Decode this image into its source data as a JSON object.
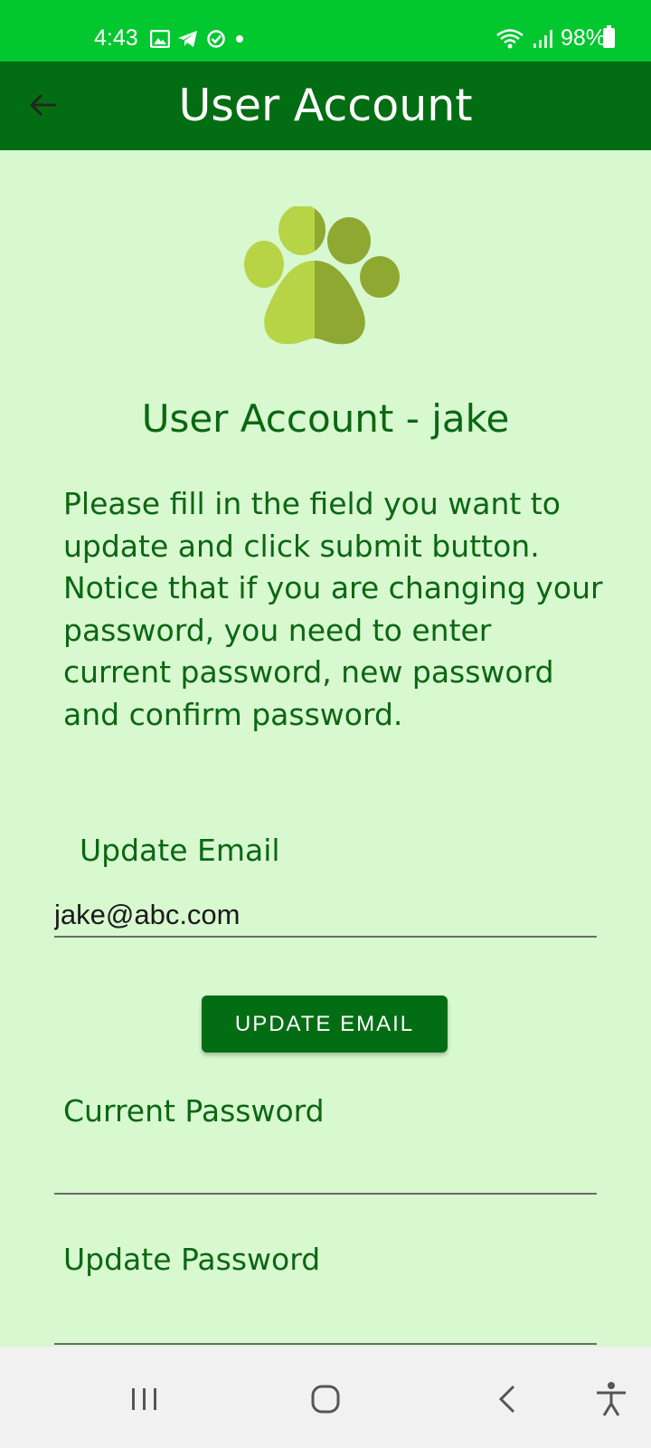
{
  "status_bar": {
    "time": "4:43",
    "battery": "98%",
    "left_icons": [
      "gallery-icon",
      "telegram-icon",
      "check-circle-icon",
      "dot-icon"
    ],
    "right_icons": [
      "wifi-icon",
      "signal-icon",
      "battery-icon"
    ]
  },
  "app_bar": {
    "title": "User Account",
    "back_icon": "back-arrow-icon"
  },
  "main": {
    "logo_icon": "paw-icon",
    "heading": "User Account - jake",
    "instructions": "Please fill in the field you want to update and click submit button. Notice that if you are changing your password, you need to enter current password, new password and confirm password.",
    "email_label": "Update Email",
    "email_value": "jake@abc.com",
    "update_email_button": "UPDATE EMAIL",
    "current_password_label": "Current Password",
    "current_password_value": "",
    "update_password_label": "Update Password",
    "update_password_value": ""
  },
  "nav_bar": {
    "icons": [
      "recent-apps-icon",
      "home-icon",
      "back-icon",
      "accessibility-icon"
    ]
  },
  "colors": {
    "status_bar": "#02c72f",
    "app_bar": "#036d13",
    "background": "#d8f8d0",
    "text_green": "#0b6712",
    "paw_light": "#b6d446",
    "paw_dark": "#8ea832"
  }
}
